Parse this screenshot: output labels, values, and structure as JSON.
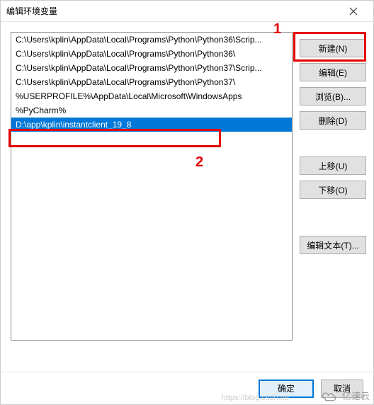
{
  "dialog": {
    "title": "编辑环境变量"
  },
  "list": {
    "items": [
      "C:\\Users\\kplin\\AppData\\Local\\Programs\\Python\\Python36\\Scrip...",
      "C:\\Users\\kplin\\AppData\\Local\\Programs\\Python\\Python36\\",
      "C:\\Users\\kplin\\AppData\\Local\\Programs\\Python\\Python37\\Scrip...",
      "C:\\Users\\kplin\\AppData\\Local\\Programs\\Python\\Python37\\",
      "%USERPROFILE%\\AppData\\Local\\Microsoft\\WindowsApps",
      "%PyCharm%",
      "D:\\app\\kplin\\instantclient_19_8"
    ],
    "selected_index": 6
  },
  "buttons": {
    "new": "新建(N)",
    "edit": "编辑(E)",
    "browse": "浏览(B)...",
    "delete": "删除(D)",
    "move_up": "上移(U)",
    "move_down": "下移(O)",
    "edit_text": "编辑文本(T)..."
  },
  "bottom": {
    "ok": "确定",
    "cancel": "取消"
  },
  "annotations": {
    "num1": "1",
    "num2": "2"
  },
  "watermark": {
    "brand": "亿速云",
    "url": "https://blog.csdn.ne"
  }
}
